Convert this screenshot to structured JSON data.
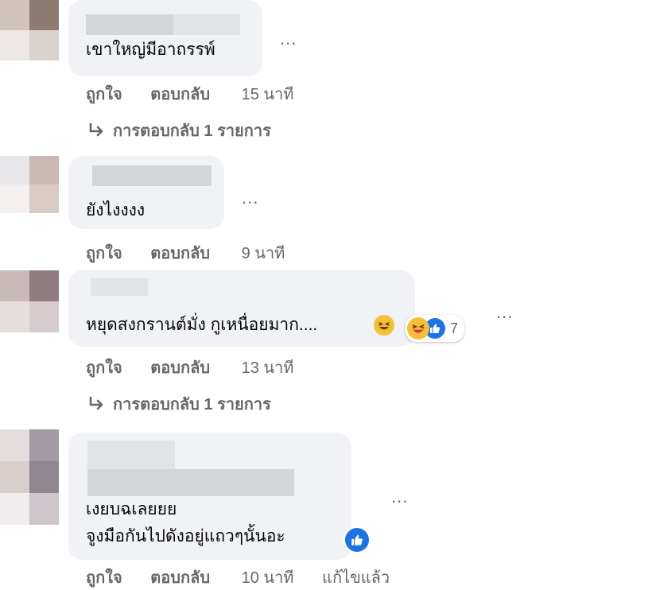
{
  "comments": [
    {
      "text_lines": [
        "เขาใหญ่มีอาถรรพ์"
      ],
      "actions": {
        "like": "ถูกใจ",
        "reply": "ตอบกลับ",
        "time": "15 นาที"
      },
      "replies_label": "การตอบกลับ 1 รายการ"
    },
    {
      "text_lines": [
        "ยังไงงงง"
      ],
      "actions": {
        "like": "ถูกใจ",
        "reply": "ตอบกลับ",
        "time": "9 นาที"
      }
    },
    {
      "text_lines": [
        "หยุดสงกรานต์มั่ง กูเหนื่อยมาก...."
      ],
      "reaction_count": "7",
      "actions": {
        "like": "ถูกใจ",
        "reply": "ตอบกลับ",
        "time": "13 นาที"
      },
      "replies_label": "การตอบกลับ 1 รายการ"
    },
    {
      "text_lines": [
        "เงยบฉเลยยย",
        "จูงมือกันไปดังอยู่แถวๆนั้นอะ"
      ],
      "actions": {
        "like": "ถูกใจ",
        "reply": "ตอบกลับ",
        "time": "10 นาที",
        "edited": "แก้ไขแล้ว"
      }
    }
  ],
  "more_options_label": "...",
  "icons": {
    "more": "more-options-icon",
    "reply_arrow": "reply-arrow-icon",
    "like": "like-reaction-icon",
    "haha": "haha-reaction-icon"
  },
  "colors": {
    "bubble": "#f0f2f5",
    "secondary_text": "#65676b",
    "like_blue": "#1b74e4",
    "haha_yellow": "#f7c034"
  }
}
